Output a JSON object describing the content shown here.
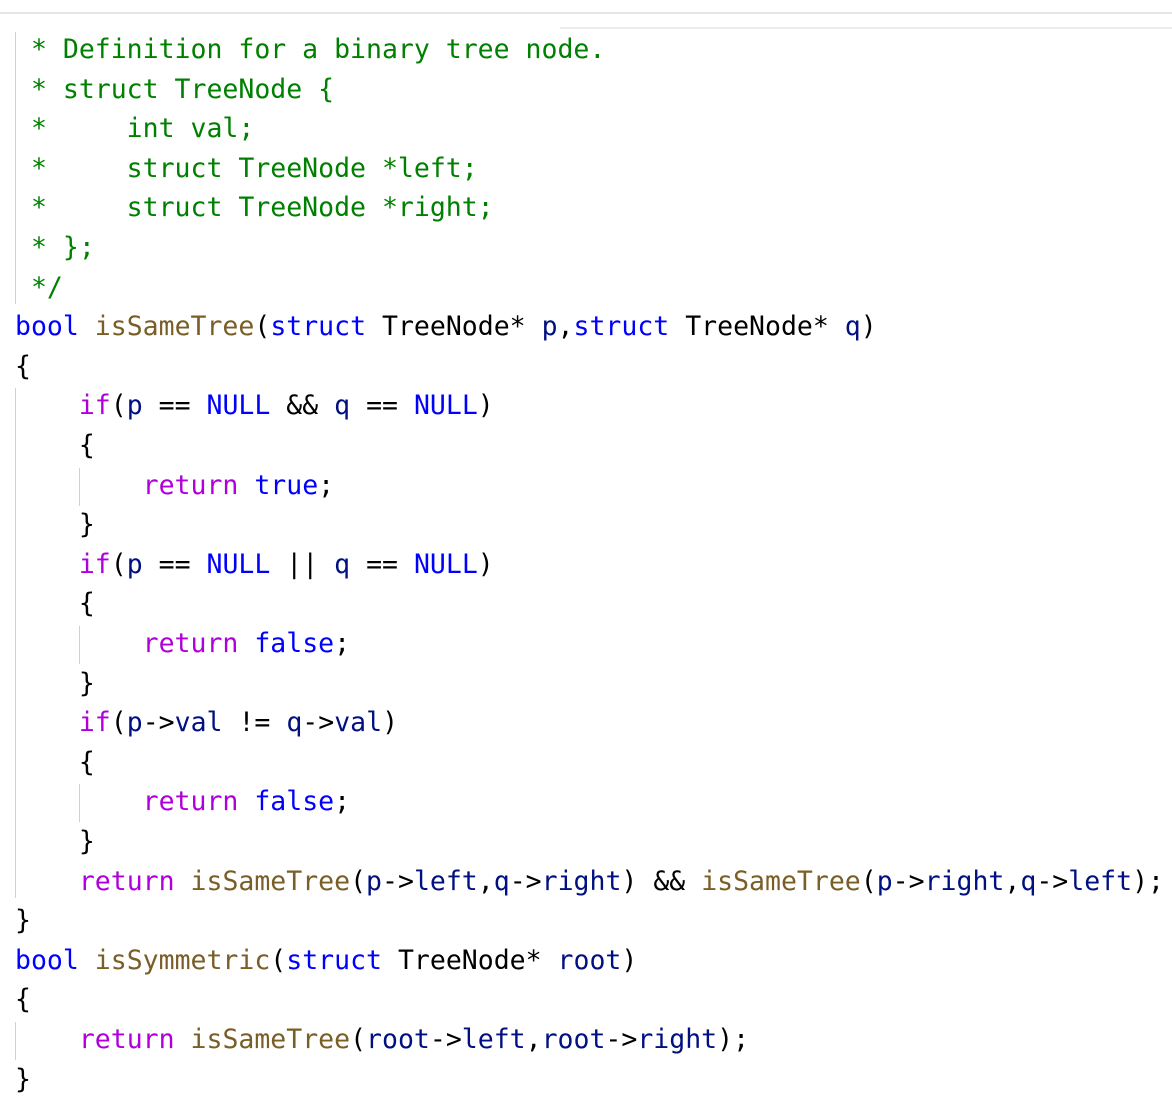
{
  "colors": {
    "comment": "#008000",
    "keyword": "#0000ff",
    "control": "#af00db",
    "function": "#795e26",
    "identifier": "#001080",
    "plain": "#000000",
    "guide": "#d0d0d0",
    "background": "#ffffff"
  },
  "code_lines": [
    [
      {
        "c": "cm",
        "t": " * Definition for a binary tree node."
      }
    ],
    [
      {
        "c": "cm",
        "t": " * struct TreeNode {"
      }
    ],
    [
      {
        "c": "cm",
        "t": " *     int val;"
      }
    ],
    [
      {
        "c": "cm",
        "t": " *     struct TreeNode *left;"
      }
    ],
    [
      {
        "c": "cm",
        "t": " *     struct TreeNode *right;"
      }
    ],
    [
      {
        "c": "cm",
        "t": " * };"
      }
    ],
    [
      {
        "c": "cm",
        "t": " */"
      }
    ],
    [
      {
        "c": "kw",
        "t": "bool"
      },
      {
        "c": "pl",
        "t": " "
      },
      {
        "c": "fn",
        "t": "isSameTree"
      },
      {
        "c": "pl",
        "t": "("
      },
      {
        "c": "kw",
        "t": "struct"
      },
      {
        "c": "pl",
        "t": " "
      },
      {
        "c": "ty",
        "t": "TreeNode"
      },
      {
        "c": "pl",
        "t": "* "
      },
      {
        "c": "id",
        "t": "p"
      },
      {
        "c": "pl",
        "t": ","
      },
      {
        "c": "kw",
        "t": "struct"
      },
      {
        "c": "pl",
        "t": " "
      },
      {
        "c": "ty",
        "t": "TreeNode"
      },
      {
        "c": "pl",
        "t": "* "
      },
      {
        "c": "id",
        "t": "q"
      },
      {
        "c": "pl",
        "t": ")"
      }
    ],
    [
      {
        "c": "pl",
        "t": "{"
      }
    ],
    [
      {
        "c": "pl",
        "t": "    "
      },
      {
        "c": "ctl",
        "t": "if"
      },
      {
        "c": "pl",
        "t": "("
      },
      {
        "c": "id",
        "t": "p"
      },
      {
        "c": "pl",
        "t": " == "
      },
      {
        "c": "kw",
        "t": "NULL"
      },
      {
        "c": "pl",
        "t": " && "
      },
      {
        "c": "id",
        "t": "q"
      },
      {
        "c": "pl",
        "t": " == "
      },
      {
        "c": "kw",
        "t": "NULL"
      },
      {
        "c": "pl",
        "t": ")"
      }
    ],
    [
      {
        "c": "pl",
        "t": "    {"
      }
    ],
    [
      {
        "c": "pl",
        "t": "        "
      },
      {
        "c": "ctl",
        "t": "return"
      },
      {
        "c": "pl",
        "t": " "
      },
      {
        "c": "kw",
        "t": "true"
      },
      {
        "c": "pl",
        "t": ";"
      }
    ],
    [
      {
        "c": "pl",
        "t": "    }"
      }
    ],
    [
      {
        "c": "pl",
        "t": "    "
      },
      {
        "c": "ctl",
        "t": "if"
      },
      {
        "c": "pl",
        "t": "("
      },
      {
        "c": "id",
        "t": "p"
      },
      {
        "c": "pl",
        "t": " == "
      },
      {
        "c": "kw",
        "t": "NULL"
      },
      {
        "c": "pl",
        "t": " || "
      },
      {
        "c": "id",
        "t": "q"
      },
      {
        "c": "pl",
        "t": " == "
      },
      {
        "c": "kw",
        "t": "NULL"
      },
      {
        "c": "pl",
        "t": ")"
      }
    ],
    [
      {
        "c": "pl",
        "t": "    {"
      }
    ],
    [
      {
        "c": "pl",
        "t": "        "
      },
      {
        "c": "ctl",
        "t": "return"
      },
      {
        "c": "pl",
        "t": " "
      },
      {
        "c": "kw",
        "t": "false"
      },
      {
        "c": "pl",
        "t": ";"
      }
    ],
    [
      {
        "c": "pl",
        "t": "    }"
      }
    ],
    [
      {
        "c": "pl",
        "t": "    "
      },
      {
        "c": "ctl",
        "t": "if"
      },
      {
        "c": "pl",
        "t": "("
      },
      {
        "c": "id",
        "t": "p"
      },
      {
        "c": "pl",
        "t": "->"
      },
      {
        "c": "id",
        "t": "val"
      },
      {
        "c": "pl",
        "t": " != "
      },
      {
        "c": "id",
        "t": "q"
      },
      {
        "c": "pl",
        "t": "->"
      },
      {
        "c": "id",
        "t": "val"
      },
      {
        "c": "pl",
        "t": ")"
      }
    ],
    [
      {
        "c": "pl",
        "t": "    {"
      }
    ],
    [
      {
        "c": "pl",
        "t": "        "
      },
      {
        "c": "ctl",
        "t": "return"
      },
      {
        "c": "pl",
        "t": " "
      },
      {
        "c": "kw",
        "t": "false"
      },
      {
        "c": "pl",
        "t": ";"
      }
    ],
    [
      {
        "c": "pl",
        "t": "    }"
      }
    ],
    [
      {
        "c": "pl",
        "t": "    "
      },
      {
        "c": "ctl",
        "t": "return"
      },
      {
        "c": "pl",
        "t": " "
      },
      {
        "c": "fn",
        "t": "isSameTree"
      },
      {
        "c": "pl",
        "t": "("
      },
      {
        "c": "id",
        "t": "p"
      },
      {
        "c": "pl",
        "t": "->"
      },
      {
        "c": "id",
        "t": "left"
      },
      {
        "c": "pl",
        "t": ","
      },
      {
        "c": "id",
        "t": "q"
      },
      {
        "c": "pl",
        "t": "->"
      },
      {
        "c": "id",
        "t": "right"
      },
      {
        "c": "pl",
        "t": ") && "
      },
      {
        "c": "fn",
        "t": "isSameTree"
      },
      {
        "c": "pl",
        "t": "("
      },
      {
        "c": "id",
        "t": "p"
      },
      {
        "c": "pl",
        "t": "->"
      },
      {
        "c": "id",
        "t": "right"
      },
      {
        "c": "pl",
        "t": ","
      },
      {
        "c": "id",
        "t": "q"
      },
      {
        "c": "pl",
        "t": "->"
      },
      {
        "c": "id",
        "t": "left"
      },
      {
        "c": "pl",
        "t": ");"
      }
    ],
    [
      {
        "c": "pl",
        "t": "}"
      }
    ],
    [
      {
        "c": "kw",
        "t": "bool"
      },
      {
        "c": "pl",
        "t": " "
      },
      {
        "c": "fn",
        "t": "isSymmetric"
      },
      {
        "c": "pl",
        "t": "("
      },
      {
        "c": "kw",
        "t": "struct"
      },
      {
        "c": "pl",
        "t": " "
      },
      {
        "c": "ty",
        "t": "TreeNode"
      },
      {
        "c": "pl",
        "t": "* "
      },
      {
        "c": "id",
        "t": "root"
      },
      {
        "c": "pl",
        "t": ")"
      }
    ],
    [
      {
        "c": "pl",
        "t": "{"
      }
    ],
    [
      {
        "c": "pl",
        "t": "    "
      },
      {
        "c": "ctl",
        "t": "return"
      },
      {
        "c": "pl",
        "t": " "
      },
      {
        "c": "fn",
        "t": "isSameTree"
      },
      {
        "c": "pl",
        "t": "("
      },
      {
        "c": "id",
        "t": "root"
      },
      {
        "c": "pl",
        "t": "->"
      },
      {
        "c": "id",
        "t": "left"
      },
      {
        "c": "pl",
        "t": ","
      },
      {
        "c": "id",
        "t": "root"
      },
      {
        "c": "pl",
        "t": "->"
      },
      {
        "c": "id",
        "t": "right"
      },
      {
        "c": "pl",
        "t": ");"
      }
    ],
    [
      {
        "c": "pl",
        "t": "}"
      }
    ]
  ]
}
